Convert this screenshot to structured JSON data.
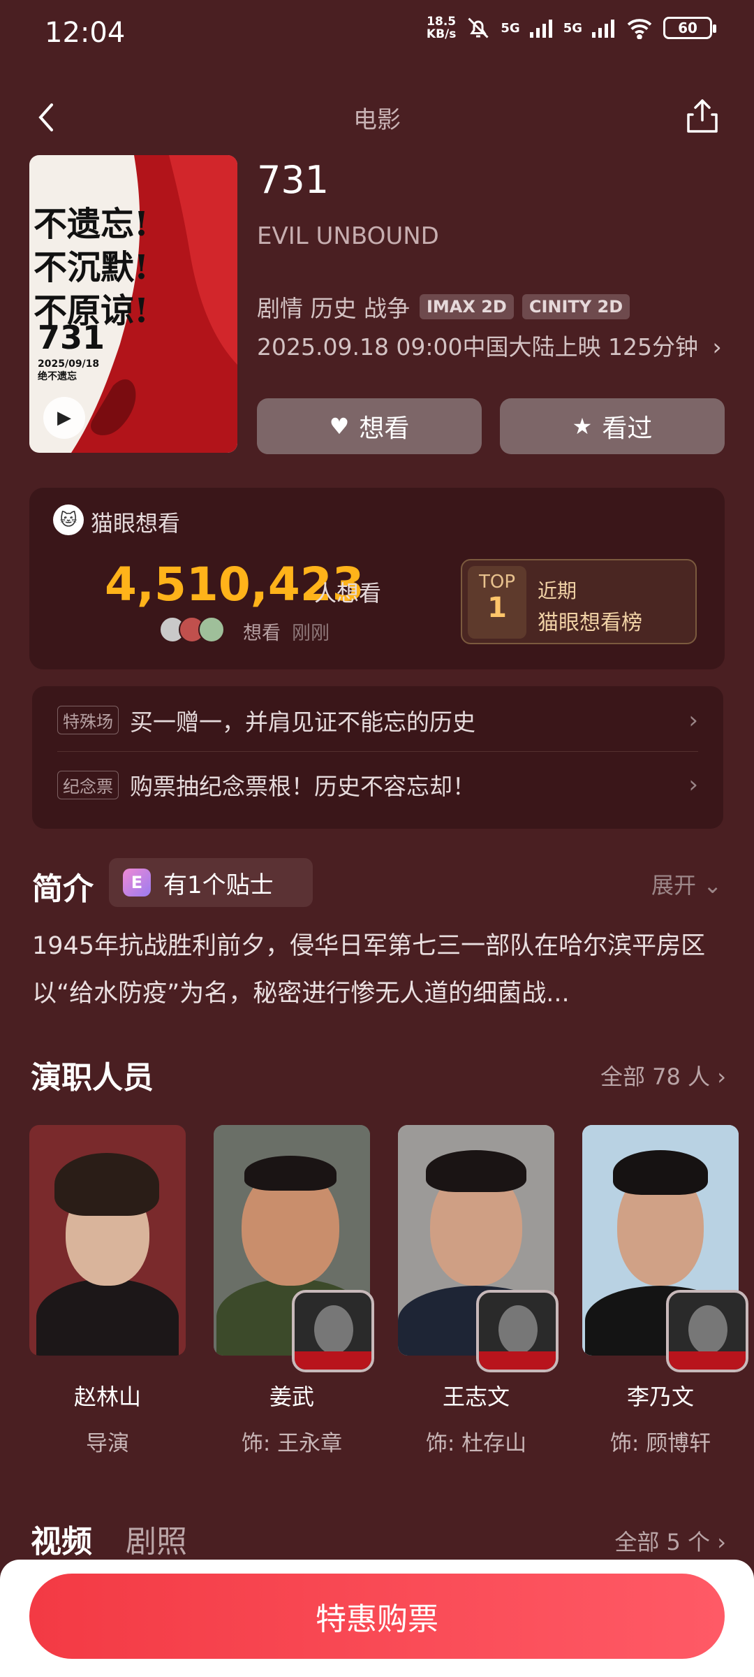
{
  "status_bar": {
    "time": "12:04",
    "speed_value": "18.5",
    "speed_unit": "KB/s",
    "network1": "5G",
    "network2": "5G",
    "battery": "60"
  },
  "nav": {
    "title": "电影"
  },
  "poster": {
    "slogan_line1": "不遗忘!",
    "slogan_line2": "不沉默!",
    "slogan_line3": "不原谅!",
    "number": "731",
    "date": "2025/09/18",
    "date_sub": "绝不遗忘"
  },
  "movie": {
    "title": "731",
    "english_title": "EVIL UNBOUND",
    "genres": "剧情 历史 战争",
    "badges": [
      "IMAX 2D",
      "CINITY 2D"
    ],
    "release_info": "2025.09.18 09:00中国大陆上映 125分钟",
    "want_label": "想看",
    "watched_label": "看过"
  },
  "want_card": {
    "label": "猫眼想看",
    "count": "4,510,423",
    "count_unit": "人想看",
    "sub_text": "想看",
    "sub_time": "刚刚",
    "rank_top": "TOP",
    "rank_num": "1",
    "rank_line1": "近期",
    "rank_line2": "猫眼想看榜"
  },
  "promos": [
    {
      "tag": "特殊场",
      "text": "买一赠一，并肩见证不能忘的历史"
    },
    {
      "tag": "纪念票",
      "text": "购票抽纪念票根！历史不容忘却！"
    }
  ],
  "intro": {
    "heading": "简介",
    "tip": "有1个贴士",
    "expand": "展开",
    "text": "1945年抗战胜利前夕，侵华日军第七三一部队在哈尔滨平房区以“给水防疫”为名，秘密进行惨无人道的细菌战..."
  },
  "cast": {
    "heading": "演职人员",
    "all_label": "全部 78 人",
    "members": [
      {
        "name": "赵林山",
        "role": "导演"
      },
      {
        "name": "姜武",
        "role": "饰: 王永章"
      },
      {
        "name": "王志文",
        "role": "饰: 杜存山"
      },
      {
        "name": "李乃文",
        "role": "饰: 顾博轩"
      }
    ]
  },
  "media_tabs": {
    "video": "视频",
    "stills": "剧照",
    "all_label": "全部 5 个"
  },
  "buy_button": "特惠购票",
  "colors": {
    "background": "#4a1f22",
    "accent_count": "#ffb31a",
    "buy_button": "#f33a44"
  }
}
